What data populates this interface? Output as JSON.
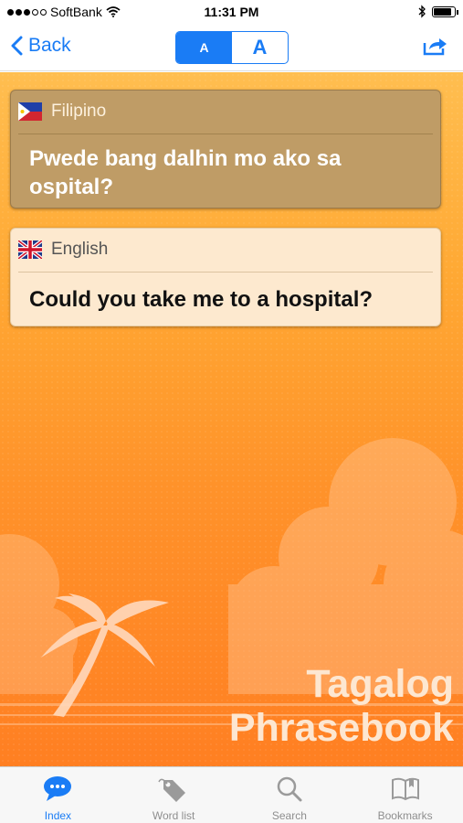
{
  "status_bar": {
    "carrier": "SoftBank",
    "time": "11:31 PM",
    "signal_dots_filled": 3,
    "signal_dots_total": 5,
    "battery_level": 0.9
  },
  "nav_bar": {
    "back_label": "Back",
    "font_small_label": "A",
    "font_large_label": "A",
    "selected_font_size": "small"
  },
  "cards": {
    "filipino": {
      "language": "Filipino",
      "phrase": "Pwede bang dalhin mo ako sa ospital?"
    },
    "english": {
      "language": "English",
      "phrase": "Could you take me to a hospital?"
    }
  },
  "branding": {
    "line1": "Tagalog",
    "line2": "Phrasebook"
  },
  "tabs": [
    {
      "label": "Index",
      "icon": "speech-bubble-icon",
      "active": true
    },
    {
      "label": "Word list",
      "icon": "tag-icon",
      "active": false
    },
    {
      "label": "Search",
      "icon": "magnifier-icon",
      "active": false
    },
    {
      "label": "Bookmarks",
      "icon": "open-book-icon",
      "active": false
    }
  ],
  "colors": {
    "accent": "#1a7cf5",
    "background_orange": "#ff922a",
    "filipino_card": "#bf9c66",
    "english_card": "#fde9cf"
  }
}
